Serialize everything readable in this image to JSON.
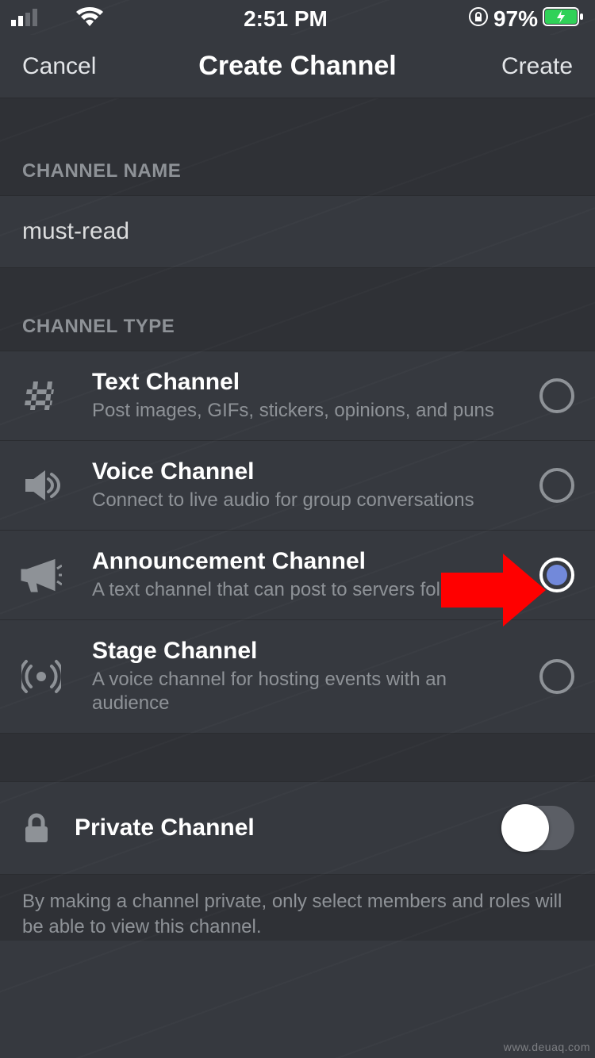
{
  "status_bar": {
    "time": "2:51 PM",
    "battery_pct": "97%"
  },
  "nav": {
    "cancel": "Cancel",
    "title": "Create Channel",
    "create": "Create"
  },
  "section_name_header": "CHANNEL NAME",
  "channel_name_value": "must-read",
  "section_type_header": "CHANNEL TYPE",
  "types": [
    {
      "title": "Text Channel",
      "subtitle": "Post images, GIFs, stickers, opinions, and puns",
      "selected": false
    },
    {
      "title": "Voice Channel",
      "subtitle": "Connect to live audio for group conversations",
      "selected": false
    },
    {
      "title": "Announcement Channel",
      "subtitle": "A text channel that can post to servers following it",
      "selected": true
    },
    {
      "title": "Stage Channel",
      "subtitle": "A voice channel for hosting events with an audience",
      "selected": false
    }
  ],
  "private": {
    "title": "Private Channel",
    "enabled": false
  },
  "private_footnote": "By making a channel private, only select members and roles will be able to view this channel.",
  "watermark": "www.deuaq.com"
}
